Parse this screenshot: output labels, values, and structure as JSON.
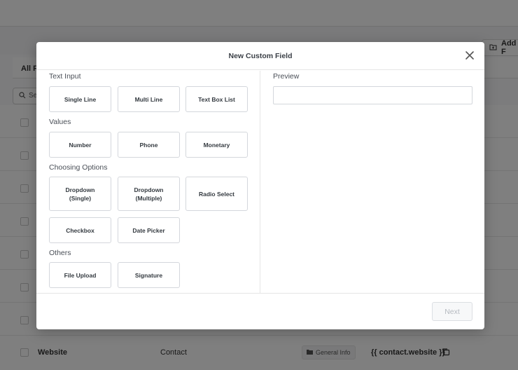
{
  "background": {
    "add_button_label": "Add F",
    "tab_label": "All F",
    "search_placeholder": "Se",
    "last_row": {
      "name": "Website",
      "object": "Contact",
      "folder": "General Info",
      "key": "{{ contact.website }}"
    }
  },
  "modal": {
    "title": "New Custom Field",
    "sections": {
      "text_input": "Text Input",
      "values": "Values",
      "choosing_options": "Choosing Options",
      "others": "Others"
    },
    "buttons": {
      "single_line": "Single Line",
      "multi_line": "Multi Line",
      "text_box_list": "Text Box List",
      "number": "Number",
      "phone": "Phone",
      "monetary": "Monetary",
      "dropdown_single": "Dropdown\n(Single)",
      "dropdown_multiple": "Dropdown\n(Multiple)",
      "radio_select": "Radio Select",
      "checkbox": "Checkbox",
      "date_picker": "Date Picker",
      "file_upload": "File Upload",
      "signature": "Signature"
    },
    "preview_label": "Preview",
    "next_label": "Next"
  }
}
